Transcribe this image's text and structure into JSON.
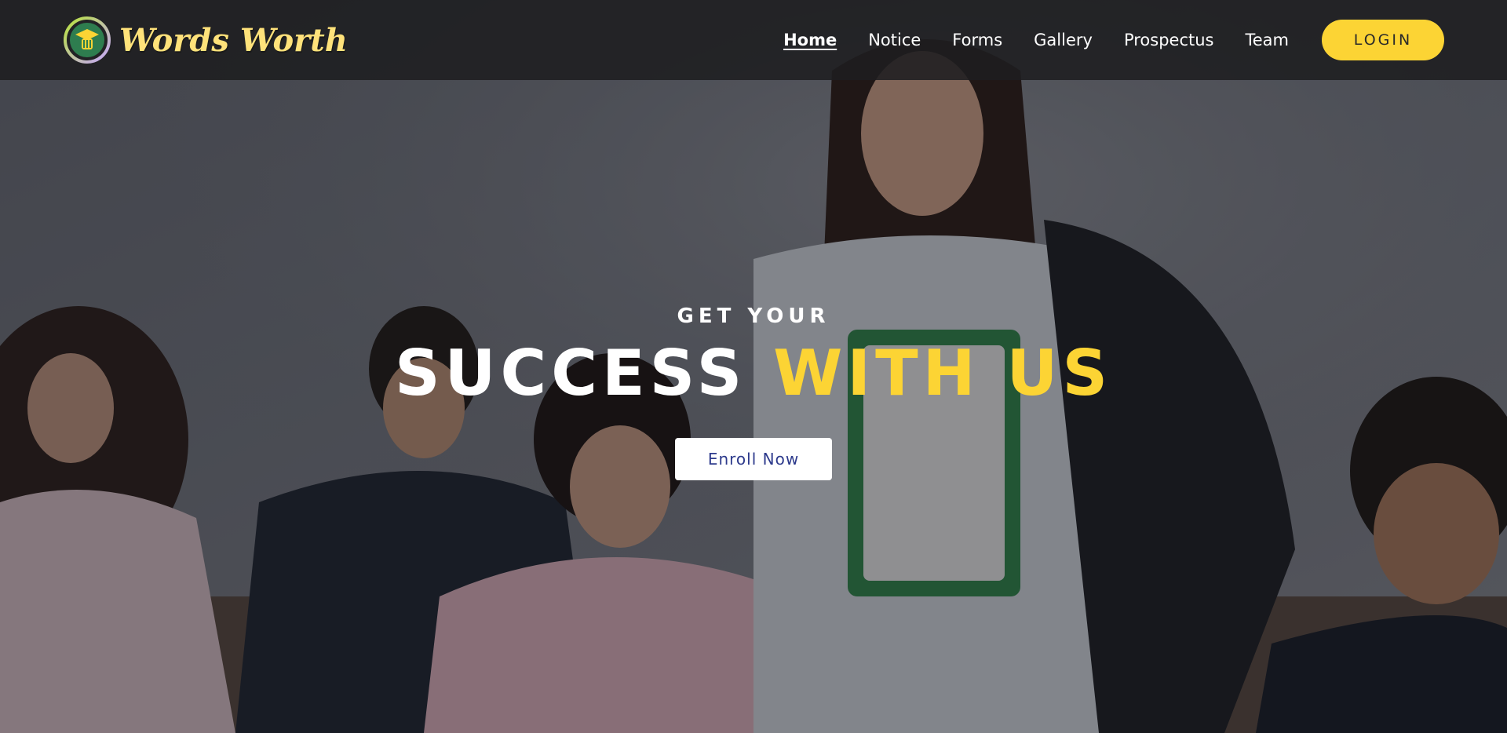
{
  "brand": {
    "name": "Words Worth",
    "logo_icon": "graduation-cap-hand-icon",
    "name_color": "#ffe27a"
  },
  "nav": {
    "items": [
      {
        "label": "Home",
        "active": true
      },
      {
        "label": "Notice",
        "active": false
      },
      {
        "label": "Forms",
        "active": false
      },
      {
        "label": "Gallery",
        "active": false
      },
      {
        "label": "Prospectus",
        "active": false
      },
      {
        "label": "Team",
        "active": false
      }
    ],
    "login_label": "LOGIN"
  },
  "hero": {
    "subtitle": "GET YOUR",
    "title_part1": "SUCCESS",
    "title_part2": "WITH US",
    "cta_label": "Enroll Now"
  },
  "colors": {
    "accent": "#fcd434",
    "navbar": "#1e1e20",
    "cta_text": "#2d3a8c"
  }
}
